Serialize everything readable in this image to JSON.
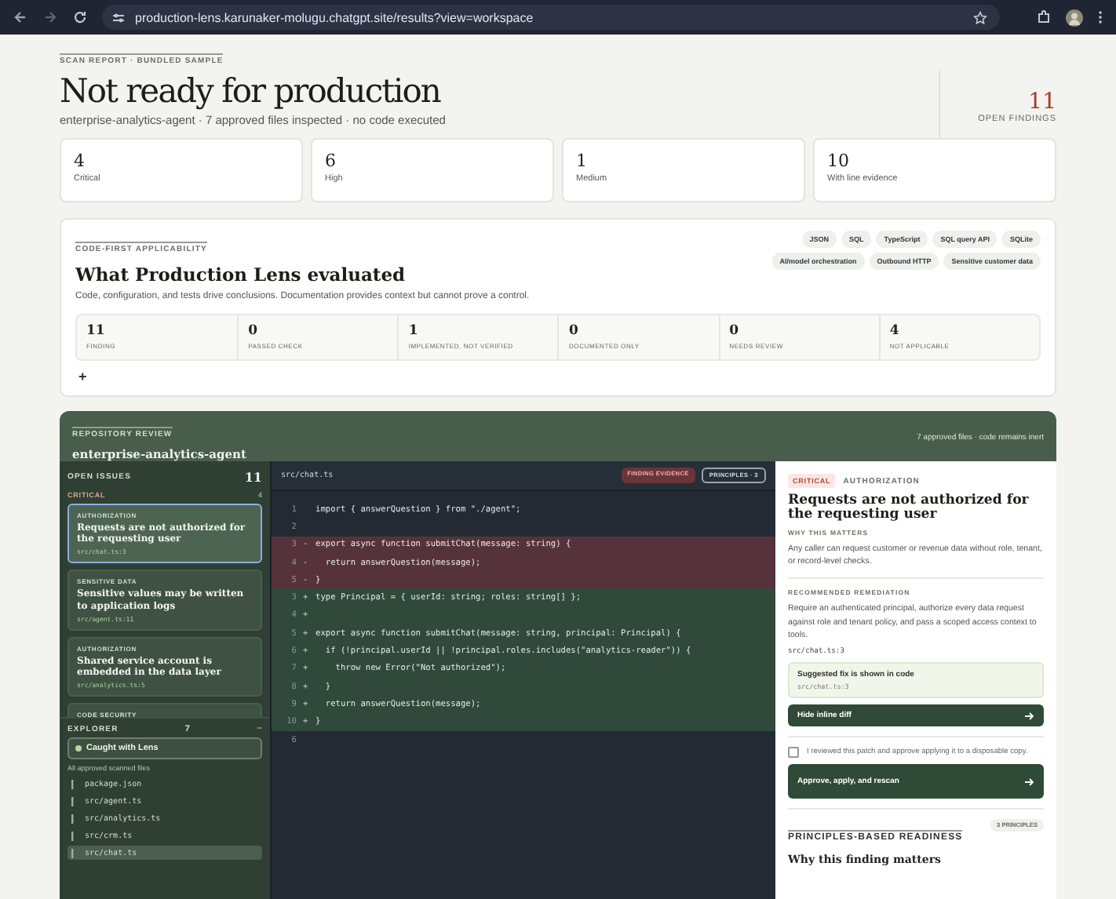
{
  "browser": {
    "url": "production-lens.karunaker-molugu.chatgpt.site/results?view=workspace"
  },
  "header": {
    "eyebrow": "SCAN REPORT · BUNDLED SAMPLE",
    "title": "Not ready for production",
    "subtitle": "enterprise-analytics-agent · 7 approved files inspected · no code executed",
    "open_count": "11",
    "open_label": "OPEN FINDINGS"
  },
  "stats": [
    {
      "value": "4",
      "label": "Critical"
    },
    {
      "value": "6",
      "label": "High"
    },
    {
      "value": "1",
      "label": "Medium"
    },
    {
      "value": "10",
      "label": "With line evidence"
    }
  ],
  "evaluated": {
    "eyebrow": "CODE-FIRST APPLICABILITY",
    "title": "What Production Lens evaluated",
    "description": "Code, configuration, and tests drive conclusions. Documentation provides context but cannot prove a control.",
    "tags": [
      "JSON",
      "SQL",
      "TypeScript",
      "SQL query API",
      "SQLite",
      "AI/model orchestration",
      "Outbound HTTP",
      "Sensitive customer data"
    ],
    "metrics": [
      {
        "value": "11",
        "label": "FINDING"
      },
      {
        "value": "0",
        "label": "PASSED CHECK"
      },
      {
        "value": "1",
        "label": "IMPLEMENTED, NOT VERIFIED"
      },
      {
        "value": "0",
        "label": "DOCUMENTED ONLY"
      },
      {
        "value": "0",
        "label": "NEEDS REVIEW"
      },
      {
        "value": "4",
        "label": "NOT APPLICABLE"
      }
    ],
    "add_label": "+"
  },
  "workspace": {
    "eyebrow": "REPOSITORY REVIEW",
    "title": "enterprise-analytics-agent",
    "note": "7 approved files · code remains inert",
    "issues": {
      "title": "OPEN ISSUES",
      "count": "11",
      "group": "CRITICAL",
      "group_count": "4",
      "items": [
        {
          "category": "AUTHORIZATION",
          "title": "Requests are not authorized for the requesting user",
          "location": "src/chat.ts:3",
          "selected": true
        },
        {
          "category": "SENSITIVE DATA",
          "title": "Sensitive values may be written to application logs",
          "location": "src/agent.ts:11",
          "selected": false
        },
        {
          "category": "AUTHORIZATION",
          "title": "Shared service account is embedded in the data layer",
          "location": "src/analytics.ts:5",
          "selected": false
        },
        {
          "category": "CODE SECURITY",
          "selected": false
        }
      ]
    },
    "explorer": {
      "title": "EXPLORER",
      "count": "7",
      "toggle": "−",
      "filter": "Caught with Lens",
      "caption": "All approved scanned files",
      "files": [
        {
          "name": "package.json",
          "selected": false
        },
        {
          "name": "src/agent.ts",
          "selected": false
        },
        {
          "name": "src/analytics.ts",
          "selected": false
        },
        {
          "name": "src/crm.ts",
          "selected": false
        },
        {
          "name": "src/chat.ts",
          "selected": true
        }
      ]
    },
    "code": {
      "file": "src/chat.ts",
      "badges": [
        {
          "kind": "evidence",
          "label": "FINDING EVIDENCE"
        },
        {
          "kind": "outline",
          "label": "PRINCIPLES · 3"
        }
      ],
      "lines": [
        {
          "kind": "context",
          "number": "1",
          "text": "import { answerQuestion } from \"./agent\";"
        },
        {
          "kind": "context",
          "number": "2"
        },
        {
          "kind": "removed",
          "number": "3",
          "sign": "-",
          "text": "export async function submitChat(message: string) {"
        },
        {
          "kind": "removed",
          "number": "4",
          "sign": "-",
          "text": "  return answerQuestion(message);"
        },
        {
          "kind": "removed",
          "number": "5",
          "sign": "-",
          "text": "}"
        },
        {
          "kind": "added",
          "number": "3",
          "sign": "+",
          "text": "type Principal = { userId: string; roles: string[] };"
        },
        {
          "kind": "added",
          "number": "4",
          "sign": "+"
        },
        {
          "kind": "added",
          "number": "5",
          "sign": "+",
          "text": "export async function submitChat(message: string, principal: Principal) {"
        },
        {
          "kind": "added",
          "number": "6",
          "sign": "+",
          "text": "  if (!principal.userId || !principal.roles.includes(\"analytics-reader\")) {"
        },
        {
          "kind": "added",
          "number": "7",
          "sign": "+",
          "text": "    throw new Error(\"Not authorized\");"
        },
        {
          "kind": "added",
          "number": "8",
          "sign": "+",
          "text": "  }"
        },
        {
          "kind": "added",
          "number": "9",
          "sign": "+",
          "text": "  return answerQuestion(message);"
        },
        {
          "kind": "added",
          "number": "10",
          "sign": "+",
          "text": "}"
        },
        {
          "kind": "context",
          "number": "6"
        }
      ]
    },
    "detail": {
      "severity": "CRITICAL",
      "category": "AUTHORIZATION",
      "title": "Requests are not authorized for the requesting user",
      "why_label": "WHY THIS MATTERS",
      "why_text": "Any caller can request customer or revenue data without role, tenant, or record-level checks.",
      "remediation_label": "RECOMMENDED REMEDIATION",
      "remediation_text": "Require an authenticated principal, authorize every data request against role and tenant policy, and pass a scoped access context to tools.",
      "location": "src/chat.ts:3",
      "fix_title": "Suggested fix is shown in code",
      "fix_location": "src/chat.ts:3",
      "diff_button": "Hide inline diff",
      "consent": {
        "label": "I reviewed this patch and approve applying it to a disposable copy.",
        "checked": false
      },
      "apply_button": "Approve, apply, and rescan",
      "principles_eyebrow": "PRINCIPLES-BASED READINESS",
      "principles_count": "3 PRINCIPLES",
      "principles_title": "Why this finding matters"
    }
  }
}
